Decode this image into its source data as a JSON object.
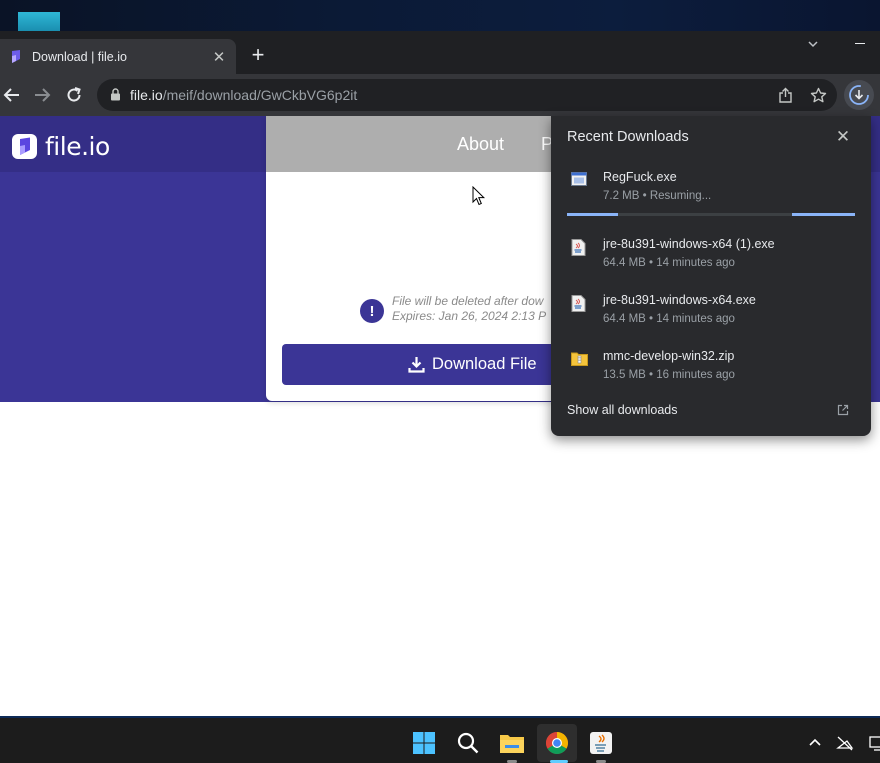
{
  "browser": {
    "tab": {
      "title": "Download | file.io"
    },
    "address": {
      "domain": "file.io",
      "path": "/meif/download/GwCkbVG6p2it"
    }
  },
  "site": {
    "logo_text": "file.io",
    "nav": {
      "about": "About",
      "partial": "P"
    },
    "notice_line1": "File will be deleted after dow",
    "notice_line2": "Expires: Jan 26, 2024 2:13 P",
    "download_button": "Download File",
    "brand_color": "#3b3596"
  },
  "downloads": {
    "title": "Recent Downloads",
    "items": [
      {
        "name": "RegFuck.exe",
        "status": "7.2 MB • Resuming...",
        "icon": "exe-window-icon"
      },
      {
        "name": "jre-8u391-windows-x64 (1).exe",
        "status": "64.4 MB • 14 minutes ago",
        "icon": "java-installer-icon"
      },
      {
        "name": "jre-8u391-windows-x64.exe",
        "status": "64.4 MB • 14 minutes ago",
        "icon": "java-installer-icon"
      },
      {
        "name": "mmc-develop-win32.zip",
        "status": "13.5 MB • 16 minutes ago",
        "icon": "zip-folder-icon"
      }
    ],
    "show_all": "Show all downloads"
  },
  "taskbar": {
    "apps": [
      "start-icon",
      "search-icon",
      "file-explorer-icon",
      "chrome-icon",
      "java-icon"
    ]
  }
}
